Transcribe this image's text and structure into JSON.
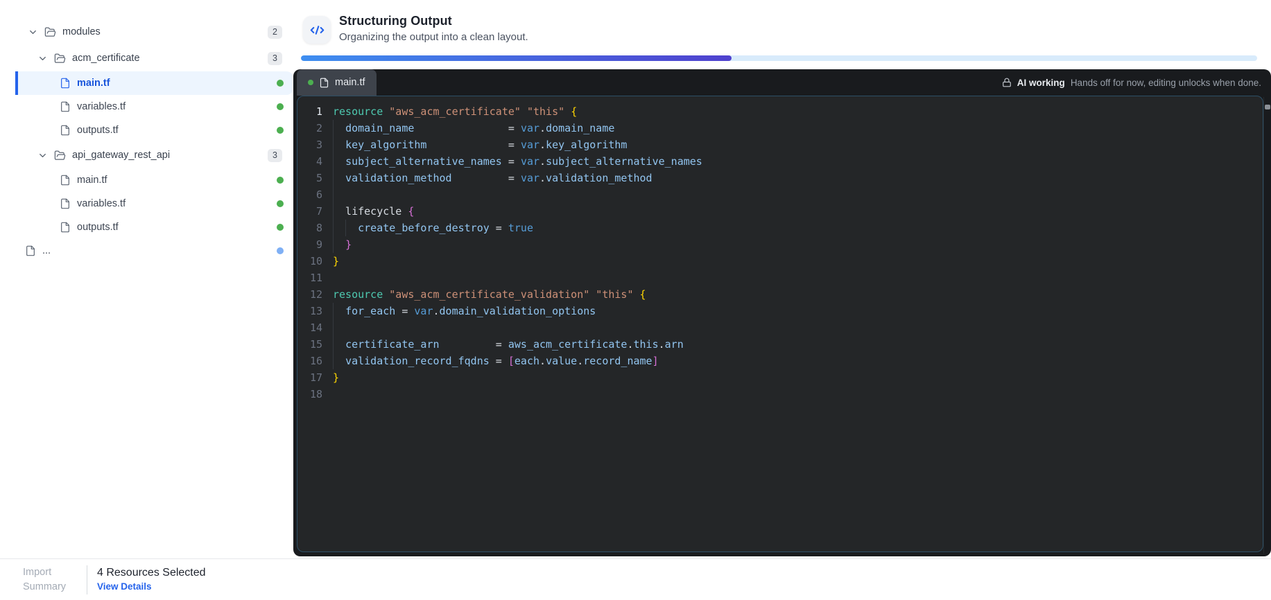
{
  "sidebar": {
    "tree": [
      {
        "kind": "folder",
        "label": "modules",
        "level": 0,
        "badge": "2",
        "expanded": true
      },
      {
        "kind": "folder",
        "label": "acm_certificate",
        "level": 1,
        "badge": "3",
        "expanded": true
      },
      {
        "kind": "file",
        "label": "main.tf",
        "level": 2,
        "dot": "green",
        "selected": true
      },
      {
        "kind": "file",
        "label": "variables.tf",
        "level": 2,
        "dot": "green"
      },
      {
        "kind": "file",
        "label": "outputs.tf",
        "level": 2,
        "dot": "green"
      },
      {
        "kind": "folder",
        "label": "api_gateway_rest_api",
        "level": 1,
        "badge": "3",
        "expanded": true
      },
      {
        "kind": "file",
        "label": "main.tf",
        "level": 2,
        "dot": "green"
      },
      {
        "kind": "file",
        "label": "variables.tf",
        "level": 2,
        "dot": "green"
      },
      {
        "kind": "file",
        "label": "outputs.tf",
        "level": 2,
        "dot": "green"
      },
      {
        "kind": "file",
        "label": "...",
        "level": 0,
        "dot": "blue"
      }
    ]
  },
  "header": {
    "title": "Structuring Output",
    "subtitle": "Organizing the output into a clean layout.",
    "icon": "code-icon",
    "progress_percent": 45
  },
  "editor": {
    "tab": {
      "label": "main.tf",
      "dot": "green"
    },
    "lock_notice": {
      "icon": "lock-icon",
      "bold": "AI working",
      "text": "Hands off for now, editing unlocks when done."
    },
    "code": {
      "language": "terraform",
      "lines": [
        {
          "n": 1,
          "g": [],
          "tk": [
            [
              "kw",
              "resource"
            ],
            [
              "pl",
              " "
            ],
            [
              "st",
              "\"aws_acm_certificate\""
            ],
            [
              "pl",
              " "
            ],
            [
              "st",
              "\"this\""
            ],
            [
              "pl",
              " "
            ],
            [
              "b1",
              "{"
            ]
          ]
        },
        {
          "n": 2,
          "g": [
            0
          ],
          "tk": [
            [
              "pl",
              "  "
            ],
            [
              "id",
              "domain_name"
            ],
            [
              "pl",
              "               = "
            ],
            [
              "kb",
              "var"
            ],
            [
              "pl",
              "."
            ],
            [
              "id",
              "domain_name"
            ]
          ]
        },
        {
          "n": 3,
          "g": [
            0
          ],
          "tk": [
            [
              "pl",
              "  "
            ],
            [
              "id",
              "key_algorithm"
            ],
            [
              "pl",
              "             = "
            ],
            [
              "kb",
              "var"
            ],
            [
              "pl",
              "."
            ],
            [
              "id",
              "key_algorithm"
            ]
          ]
        },
        {
          "n": 4,
          "g": [
            0
          ],
          "tk": [
            [
              "pl",
              "  "
            ],
            [
              "id",
              "subject_alternative_names"
            ],
            [
              "pl",
              " = "
            ],
            [
              "kb",
              "var"
            ],
            [
              "pl",
              "."
            ],
            [
              "id",
              "subject_alternative_names"
            ]
          ]
        },
        {
          "n": 5,
          "g": [
            0
          ],
          "tk": [
            [
              "pl",
              "  "
            ],
            [
              "id",
              "validation_method"
            ],
            [
              "pl",
              "         = "
            ],
            [
              "kb",
              "var"
            ],
            [
              "pl",
              "."
            ],
            [
              "id",
              "validation_method"
            ]
          ]
        },
        {
          "n": 6,
          "g": [
            0
          ],
          "tk": []
        },
        {
          "n": 7,
          "g": [
            0
          ],
          "tk": [
            [
              "pl",
              "  lifecycle "
            ],
            [
              "b2",
              "{"
            ]
          ]
        },
        {
          "n": 8,
          "g": [
            0,
            2
          ],
          "tk": [
            [
              "pl",
              "    "
            ],
            [
              "id",
              "create_before_destroy"
            ],
            [
              "pl",
              " = "
            ],
            [
              "kb",
              "true"
            ]
          ]
        },
        {
          "n": 9,
          "g": [
            0
          ],
          "tk": [
            [
              "pl",
              "  "
            ],
            [
              "b2",
              "}"
            ]
          ]
        },
        {
          "n": 10,
          "g": [],
          "tk": [
            [
              "b1",
              "}"
            ]
          ]
        },
        {
          "n": 11,
          "g": [],
          "tk": []
        },
        {
          "n": 12,
          "g": [],
          "tk": [
            [
              "kw",
              "resource"
            ],
            [
              "pl",
              " "
            ],
            [
              "st",
              "\"aws_acm_certificate_validation\""
            ],
            [
              "pl",
              " "
            ],
            [
              "st",
              "\"this\""
            ],
            [
              "pl",
              " "
            ],
            [
              "b1",
              "{"
            ]
          ]
        },
        {
          "n": 13,
          "g": [
            0
          ],
          "tk": [
            [
              "pl",
              "  "
            ],
            [
              "id",
              "for_each"
            ],
            [
              "pl",
              " = "
            ],
            [
              "kb",
              "var"
            ],
            [
              "pl",
              "."
            ],
            [
              "id",
              "domain_validation_options"
            ]
          ]
        },
        {
          "n": 14,
          "g": [
            0
          ],
          "tk": []
        },
        {
          "n": 15,
          "g": [
            0
          ],
          "tk": [
            [
              "pl",
              "  "
            ],
            [
              "id",
              "certificate_arn"
            ],
            [
              "pl",
              "         = "
            ],
            [
              "id",
              "aws_acm_certificate"
            ],
            [
              "pl",
              "."
            ],
            [
              "id",
              "this"
            ],
            [
              "pl",
              "."
            ],
            [
              "id",
              "arn"
            ]
          ]
        },
        {
          "n": 16,
          "g": [
            0
          ],
          "tk": [
            [
              "pl",
              "  "
            ],
            [
              "id",
              "validation_record_fqdns"
            ],
            [
              "pl",
              " = "
            ],
            [
              "b2",
              "["
            ],
            [
              "id",
              "each"
            ],
            [
              "pl",
              "."
            ],
            [
              "id",
              "value"
            ],
            [
              "pl",
              "."
            ],
            [
              "id",
              "record_name"
            ],
            [
              "b2",
              "]"
            ]
          ]
        },
        {
          "n": 17,
          "g": [],
          "tk": [
            [
              "b1",
              "}"
            ]
          ]
        },
        {
          "n": 18,
          "g": [],
          "tk": []
        }
      ]
    }
  },
  "footer": {
    "label_line1": "Import",
    "label_line2": "Summary",
    "status": "4 Resources Selected",
    "link": "View Details"
  },
  "colors": {
    "accent-blue": "#2563eb",
    "selected-text": "#1a56db",
    "link-blue": "#2563eb",
    "green-dot": "#4caf50",
    "blue-dot": "#7fb0f5",
    "progress-start": "#3e8ef0",
    "progress-end": "#4f41ce",
    "progress-track": "#d8ebfb",
    "code-plain": "#d6dbe1",
    "code-keyword": "#4ec9b0",
    "code-string": "#ce9178",
    "code-brace1": "#ffd602",
    "code-brace2": "#d670d6",
    "code-ident": "#92c5f0",
    "code-blue": "#569cd6"
  }
}
